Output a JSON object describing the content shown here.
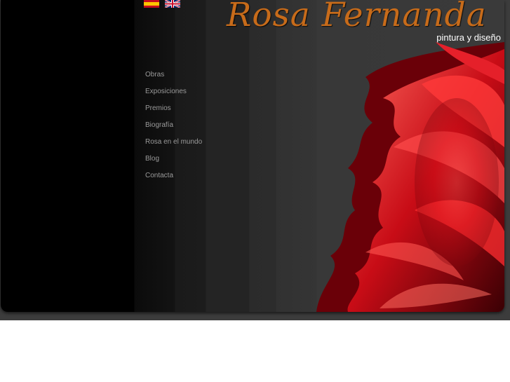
{
  "header": {
    "title": "Rosa Fernanda",
    "subtitle": "pintura y diseño",
    "title_color": "#c76b1a"
  },
  "languages": [
    {
      "name": "flag-spain-icon",
      "code": "es"
    },
    {
      "name": "flag-uk-icon",
      "code": "en"
    }
  ],
  "nav": {
    "items": [
      {
        "label": "Obras"
      },
      {
        "label": "Exposiciones"
      },
      {
        "label": "Premios"
      },
      {
        "label": "Biografía"
      },
      {
        "label": "Rosa en el mundo"
      },
      {
        "label": "Blog"
      },
      {
        "label": "Contacta"
      }
    ]
  },
  "colors": {
    "background": "#000000",
    "accent_red": "#d0101a",
    "nav_text": "#9a9a9a"
  }
}
